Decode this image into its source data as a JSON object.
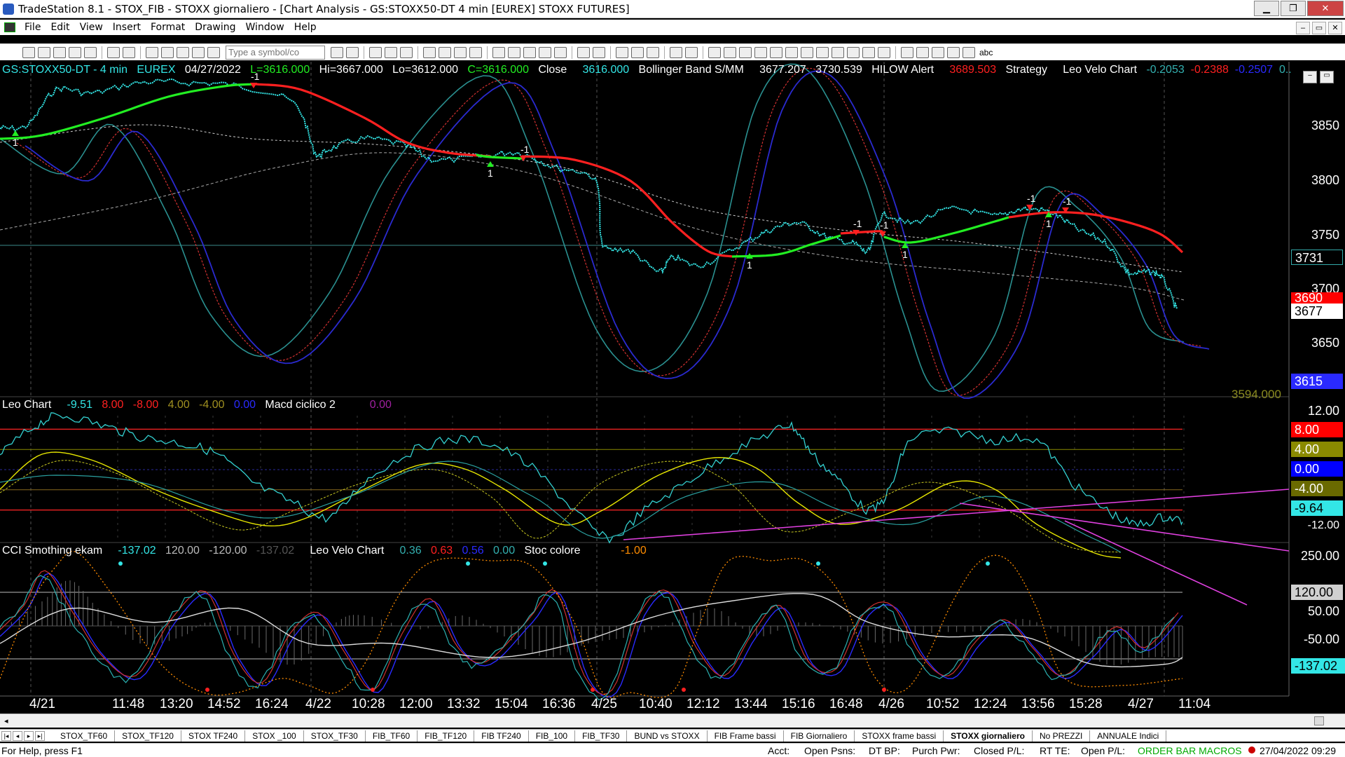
{
  "window": {
    "title": "TradeStation 8.1 - STOX_FIB - STOXX giornaliero - [Chart Analysis - GS:STOXX50-DT  4 min  [EUREX] STOXX FUTURES]",
    "min": "▁",
    "max": "❐",
    "close": "✕"
  },
  "menu": {
    "items": [
      "File",
      "Edit",
      "View",
      "Insert",
      "Format",
      "Drawing",
      "Window",
      "Help"
    ]
  },
  "toolbar": {
    "symbol_placeholder": "Type a symbol/co",
    "text_tool": "abc"
  },
  "header": {
    "symbol": "GS:STOXX50-DT - 4 min",
    "exchange": "EUREX",
    "date": "04/27/2022",
    "last": "L=3616.000",
    "high": "Hi=3667.000",
    "low": "Lo=3612.000",
    "close_c": "C=3616.000",
    "close_lbl": "Close",
    "close_val": "3616.000",
    "bb_lbl": "Bollinger Band S/MM",
    "bb1": "3677.207",
    "bb2": "3730.539",
    "hilow_lbl": "HILOW Alert",
    "hilow_val": "3689.503",
    "strategy": "Strategy",
    "leo_velo": "Leo Velo Chart",
    "lv1": "-0.2053",
    "lv2": "-0.2388",
    "lv3": "-0.2507",
    "lv4": "0.."
  },
  "price_axis": {
    "ticks": [
      "3850",
      "3800",
      "3750",
      "3700",
      "3650"
    ],
    "tag_3731": "3731",
    "tag_3690": "3690",
    "tag_3677": "3677",
    "tag_3615": "3615",
    "faded": "3594.000"
  },
  "leo_chart": {
    "name": "Leo Chart",
    "v1": "-9.51",
    "v2": "8.00",
    "v3": "-8.00",
    "v4": "4.00",
    "v5": "-4.00",
    "v6": "0.00",
    "macd": "Macd ciclico 2",
    "macd_v": "0.00",
    "axis": [
      "12.00",
      "-12.00"
    ],
    "tags": [
      "8.00",
      "4.00",
      "0.00",
      "-4.00",
      "-9.64"
    ]
  },
  "cci": {
    "name": "CCI Smothing ekam",
    "v1": "-137.02",
    "v2": "120.00",
    "v3": "-120.00",
    "v4": "-137.02",
    "leo_velo": "Leo Velo Chart",
    "lv1": "0.36",
    "lv2": "0.63",
    "lv3": "0.56",
    "lv4": "0.00",
    "stoc": "Stoc colore",
    "stoc_v": "-1.00",
    "axis": [
      "250.00",
      "50.00",
      "-50.00"
    ],
    "tags": [
      "120.00",
      "-137.02"
    ]
  },
  "signals": {
    "up": "1",
    "down": "-1"
  },
  "time_axis": [
    "4/21",
    "11:48",
    "13:20",
    "14:52",
    "16:24",
    "4/22",
    "10:28",
    "12:00",
    "13:32",
    "15:04",
    "16:36",
    "4/25",
    "10:40",
    "12:12",
    "13:44",
    "15:16",
    "16:48",
    "4/26",
    "10:52",
    "12:24",
    "13:56",
    "15:28",
    "4/27",
    "11:04"
  ],
  "sheet_tabs": [
    "STOX_TF60",
    "STOX_TF120",
    "STOX TF240",
    "STOX _100",
    "STOX_TF30",
    "FIB_TF60",
    "FIB_TF120",
    "FIB TF240",
    "FIB_100",
    "FIB_TF30",
    "BUND vs STOXX",
    "FIB Frame bassi",
    "FIB Giornaliero",
    "STOXX frame bassi",
    "STOXX giornaliero",
    "No PREZZI",
    "ANNUALE Indici"
  ],
  "status": {
    "help": "For Help, press F1",
    "acct": "Acct:",
    "open_psns": "Open Psns:",
    "dt_bp": "DT BP:",
    "purch_pwr": "Purch Pwr:",
    "closed_pl": "Closed P/L:",
    "rt_te": "RT TE:",
    "open_pl": "Open P/L:",
    "macros": "ORDER BAR  MACROS",
    "datetime": "27/04/2022 09:29"
  },
  "colors": {
    "cyan": "#33e6e6",
    "red": "#ff2020",
    "green": "#22ee22",
    "yellow": "#e6e600",
    "magenta": "#e040e0",
    "blue": "#2a2aff"
  }
}
